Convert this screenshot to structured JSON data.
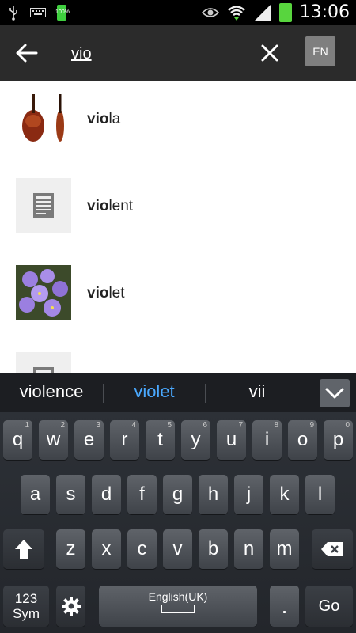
{
  "status_bar": {
    "time": "13:06",
    "battery_small_text": "100%",
    "icons": [
      "usb-icon",
      "keyboard-icon",
      "battery-icon",
      "eye-icon",
      "wifi-icon",
      "signal-icon",
      "battery-icon"
    ]
  },
  "search": {
    "query": "vio",
    "language_button": "EN"
  },
  "results": [
    {
      "match": "vio",
      "rest": "la",
      "thumb": "image"
    },
    {
      "match": "vio",
      "rest": "lent",
      "thumb": "article-icon"
    },
    {
      "match": "vio",
      "rest": "let",
      "thumb": "image"
    },
    {
      "match": "",
      "rest": "",
      "thumb": "article-icon"
    }
  ],
  "suggestions": [
    "violence",
    "violet",
    "vii"
  ],
  "keyboard": {
    "row1": [
      {
        "l": "q",
        "s": "1"
      },
      {
        "l": "w",
        "s": "2"
      },
      {
        "l": "e",
        "s": "3"
      },
      {
        "l": "r",
        "s": "4"
      },
      {
        "l": "t",
        "s": "5"
      },
      {
        "l": "y",
        "s": "6"
      },
      {
        "l": "u",
        "s": "7"
      },
      {
        "l": "i",
        "s": "8"
      },
      {
        "l": "o",
        "s": "9"
      },
      {
        "l": "p",
        "s": "0"
      }
    ],
    "row2": [
      "a",
      "s",
      "d",
      "f",
      "g",
      "h",
      "j",
      "k",
      "l"
    ],
    "row3": [
      "z",
      "x",
      "c",
      "v",
      "b",
      "n",
      "m"
    ],
    "sym_label": "123\nSym",
    "space_label": "English(UK)",
    "period_label": ".",
    "go_label": "Go"
  },
  "colors": {
    "suggestion_highlight": "#4aa9ff",
    "header_bg": "#2b2b2b",
    "keyboard_bg": "#2d3137"
  }
}
